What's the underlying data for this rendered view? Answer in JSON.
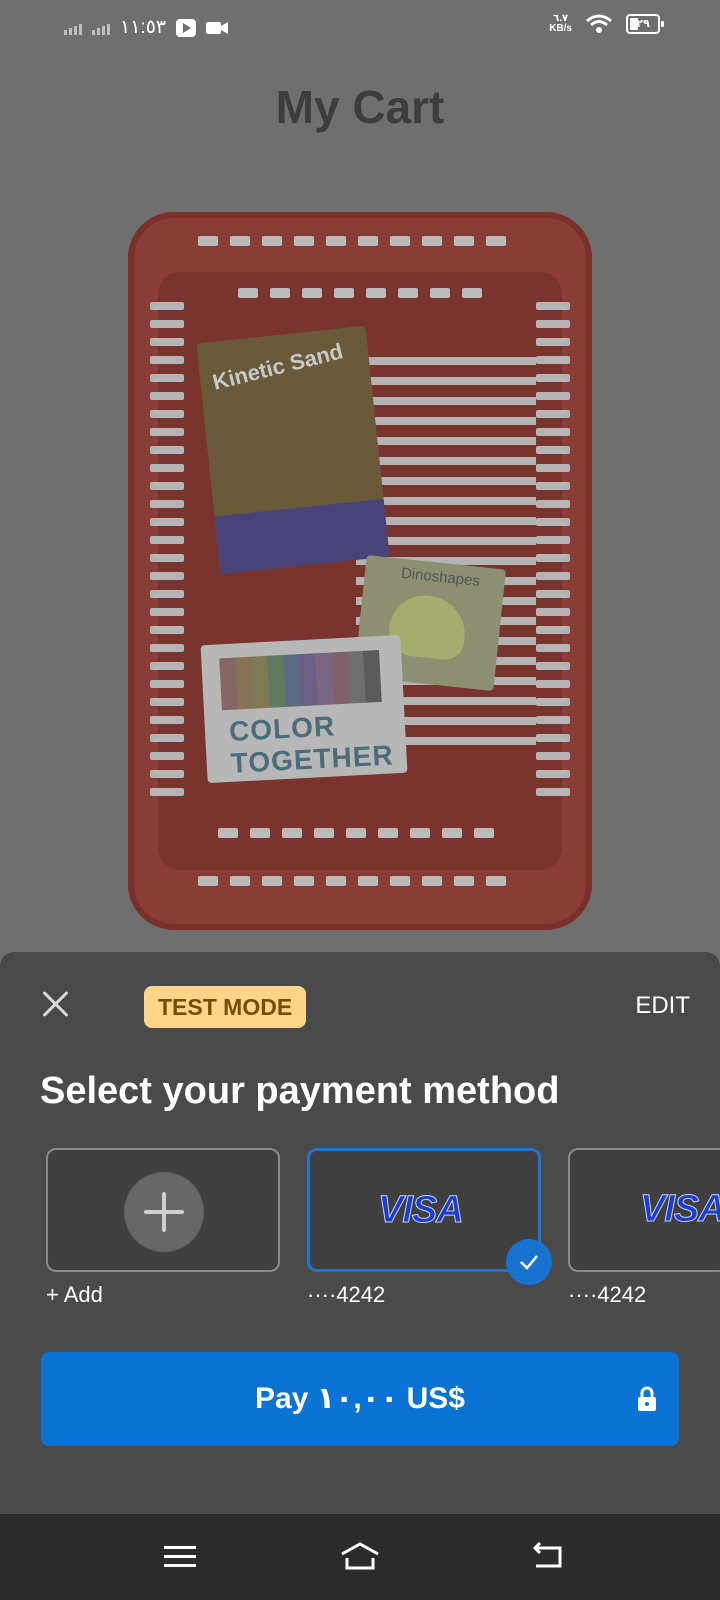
{
  "status_bar": {
    "time": "١١:٥٣",
    "net_speed": "٦.٧",
    "net_unit": "KB/s",
    "battery": "٢٩",
    "icons": [
      "signal-icon",
      "signal-icon",
      "youtube-icon",
      "video-camera-icon",
      "wifi-icon",
      "battery-icon"
    ]
  },
  "page": {
    "title": "My Cart"
  },
  "basket_illustration": {
    "products": [
      "Kinetic Sand",
      "Dinoshapes",
      "COLOR TOGETHER"
    ]
  },
  "sheet": {
    "test_mode_label": "TEST MODE",
    "edit_label": "EDIT",
    "title": "Select your payment method",
    "cards": [
      {
        "type": "add",
        "label": "+ Add"
      },
      {
        "type": "visa",
        "brand": "VISA",
        "label": "····4242",
        "selected": true
      },
      {
        "type": "visa",
        "brand": "VISA",
        "label": "····4242",
        "selected": false
      }
    ],
    "pay_label": "Pay ١٠,٠٠ US$",
    "accent_color": "#0a73d4"
  },
  "nav": {
    "icons": [
      "menu-icon",
      "home-icon",
      "back-icon"
    ]
  }
}
